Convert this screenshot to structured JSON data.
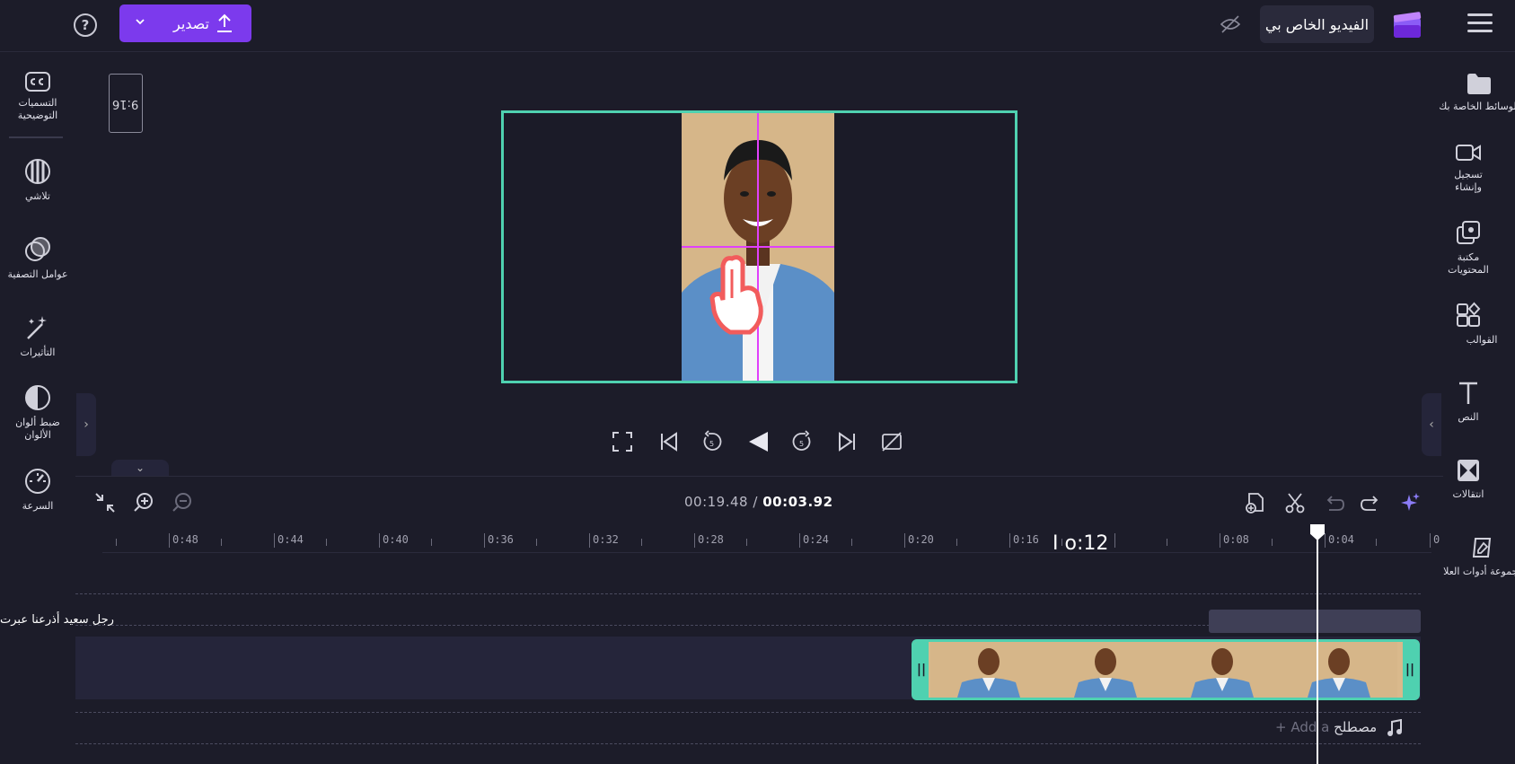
{
  "header": {
    "export_label": "تصدير",
    "help_icon": "help-circle-icon",
    "project_title": "الفيديو الخاص بي"
  },
  "left_panel": {
    "items": [
      {
        "label": "التسميات التوضيحية",
        "icon": "captions-icon"
      },
      {
        "label": "تلاشي",
        "icon": "fade-icon"
      },
      {
        "label": "عوامل التصفية",
        "icon": "filters-icon"
      },
      {
        "label": "التأثيرات",
        "icon": "effects-wand-icon"
      },
      {
        "label": "ضبط ألوان الألوان",
        "icon": "color-adjust-icon"
      },
      {
        "label": "السرعة",
        "icon": "speed-gauge-icon"
      }
    ]
  },
  "right_panel": {
    "items": [
      {
        "label": "الوسائط الخاصة بك",
        "icon": "folder-icon"
      },
      {
        "label": "تسجيل وإنشاء",
        "icon": "record-camera-icon"
      },
      {
        "label": "مكتبة المحتويات",
        "icon": "content-library-icon"
      },
      {
        "label": "القوالب",
        "icon": "templates-icon"
      },
      {
        "label": "النص",
        "icon": "text-icon"
      },
      {
        "label": "انتقالات",
        "icon": "transitions-icon"
      },
      {
        "label": "مجموعة أدوات العلامة التجارية",
        "icon": "brand-kit-icon"
      }
    ]
  },
  "preview": {
    "aspect_ratio": "9:16"
  },
  "timeline": {
    "current_time": "00:03.92",
    "separator": "/",
    "total_time": "00:19.48",
    "hover_time": "I o:12",
    "ruler_labels": [
      "0",
      "0:04",
      "0:08",
      "0:12",
      "0:16",
      "0:20",
      "0:24",
      "0:28",
      "0:32",
      "0:36",
      "0:40",
      "0:44",
      "0:48"
    ],
    "text_clip_label": "رجل سعيد أذرعنا عبرت",
    "audio_add_ghost": "+ Add a",
    "audio_add_label": "مصطلح"
  },
  "colors": {
    "accent": "#7c3aed",
    "clip_border": "#4fd1b0",
    "guides": "#e040fb",
    "background": "#1c1c29"
  }
}
